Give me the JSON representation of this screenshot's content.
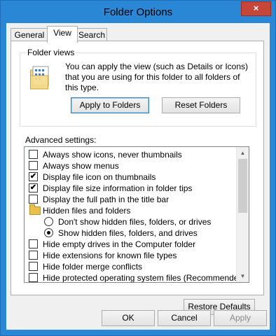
{
  "window": {
    "title": "Folder Options",
    "close_label": "×"
  },
  "tabs": [
    {
      "label": "General",
      "active": false
    },
    {
      "label": "View",
      "active": true
    },
    {
      "label": "Search",
      "active": false
    }
  ],
  "folder_views": {
    "group_label": "Folder views",
    "description": "You can apply the view (such as Details or Icons) that you are using for this folder to all folders of this type.",
    "apply_button": "Apply to Folders",
    "reset_button": "Reset Folders"
  },
  "advanced": {
    "label": "Advanced settings:",
    "items": [
      {
        "type": "checkbox",
        "label": "Always show icons, never thumbnails",
        "checked": false
      },
      {
        "type": "checkbox",
        "label": "Always show menus",
        "checked": false
      },
      {
        "type": "checkbox",
        "label": "Display file icon on thumbnails",
        "checked": true
      },
      {
        "type": "checkbox",
        "label": "Display file size information in folder tips",
        "checked": true
      },
      {
        "type": "checkbox",
        "label": "Display the full path in the title bar",
        "checked": false
      },
      {
        "type": "folder",
        "label": "Hidden files and folders"
      },
      {
        "type": "radio",
        "label": "Don't show hidden files, folders, or drives",
        "checked": false
      },
      {
        "type": "radio",
        "label": "Show hidden files, folders, and drives",
        "checked": true
      },
      {
        "type": "checkbox",
        "label": "Hide empty drives in the Computer folder",
        "checked": false
      },
      {
        "type": "checkbox",
        "label": "Hide extensions for known file types",
        "checked": false
      },
      {
        "type": "checkbox",
        "label": "Hide folder merge conflicts",
        "checked": false
      },
      {
        "type": "checkbox",
        "label": "Hide protected operating system files (Recommended)",
        "checked": false
      }
    ],
    "scroll_position": 0.0
  },
  "restore_button": "Restore Defaults",
  "footer": {
    "ok": "OK",
    "cancel": "Cancel",
    "apply": "Apply"
  },
  "glyphs": {
    "check": "✔",
    "scroll_up": "▲",
    "scroll_down": "▼"
  }
}
